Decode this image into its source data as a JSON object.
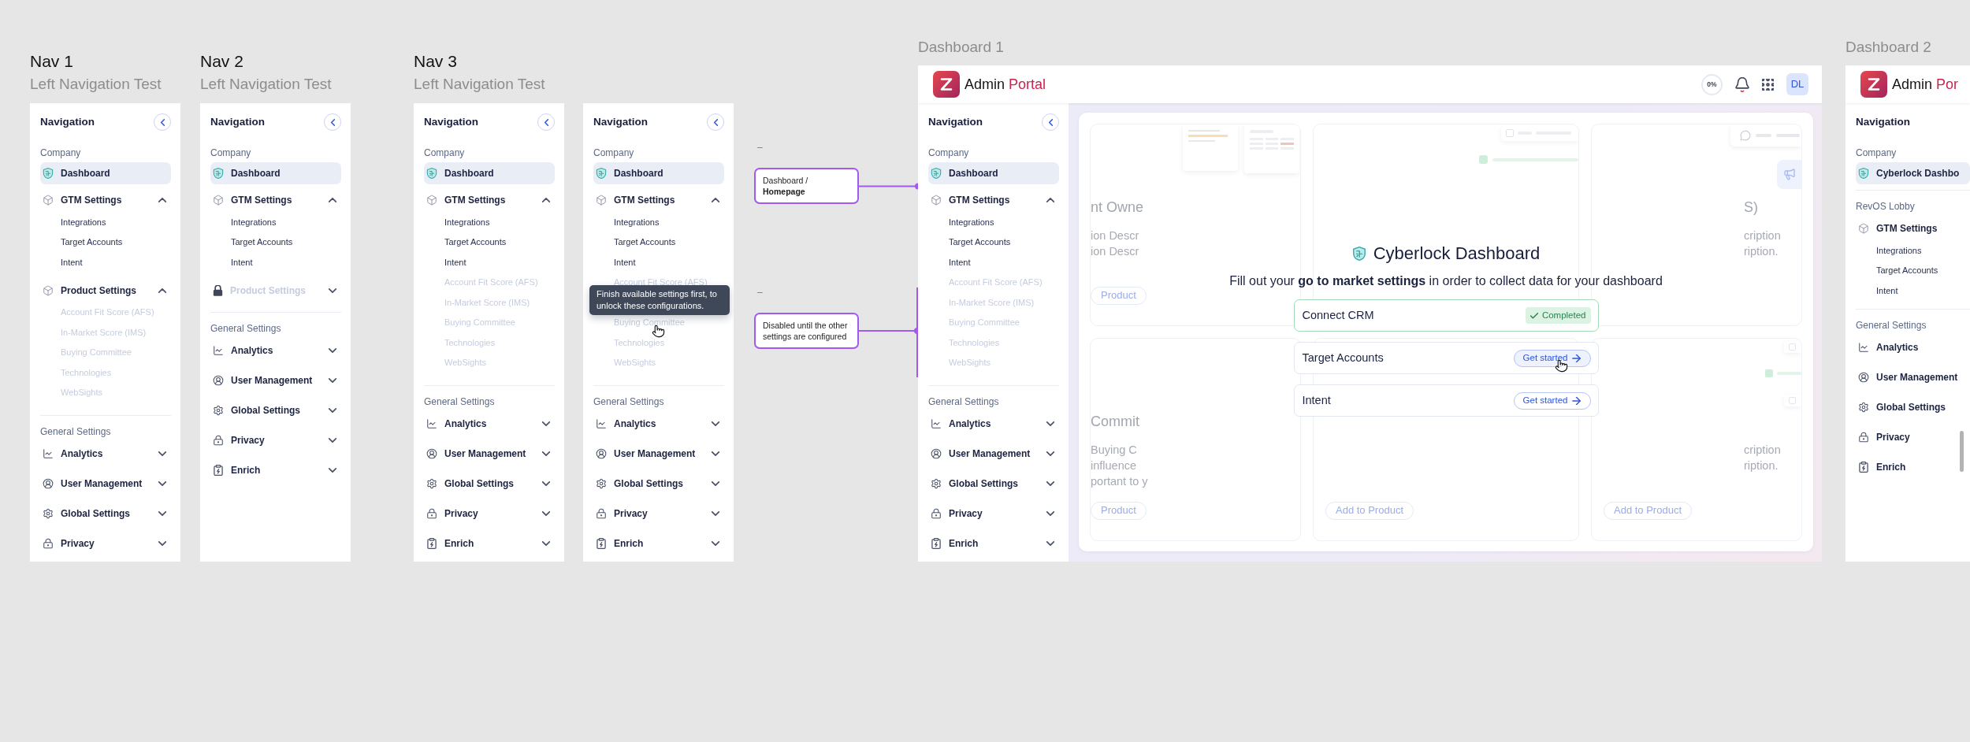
{
  "nav_frames": [
    {
      "title": "Nav 1",
      "subtitle": "Left Navigation Test",
      "panels": [
        {
          "heading": "Navigation",
          "collapsible": true,
          "sections": [
            {
              "label": "Company",
              "items": [
                {
                  "label": "Dashboard",
                  "kind": "shield",
                  "selected": true,
                  "disabled": false
                },
                {
                  "label": "GTM Settings",
                  "kind": "cube",
                  "selected": false,
                  "disabled": false,
                  "expanded": true,
                  "children": [
                    {
                      "label": "Integrations",
                      "selected": false,
                      "disabled": false
                    },
                    {
                      "label": "Target Accounts",
                      "selected": false,
                      "disabled": false
                    },
                    {
                      "label": "Intent",
                      "selected": false,
                      "disabled": false
                    }
                  ]
                },
                {
                  "label": "Product Settings",
                  "kind": "cube",
                  "selected": false,
                  "disabled": false,
                  "expanded": true,
                  "children": [
                    {
                      "label": "Account Fit Score (AFS)",
                      "selected": false,
                      "disabled": true
                    },
                    {
                      "label": "In-Market Score (IMS)",
                      "selected": false,
                      "disabled": true
                    },
                    {
                      "label": "Buying Committee",
                      "selected": false,
                      "disabled": true
                    },
                    {
                      "label": "Technologies",
                      "selected": false,
                      "disabled": true
                    },
                    {
                      "label": "WebSights",
                      "selected": false,
                      "disabled": true
                    }
                  ]
                }
              ]
            },
            {
              "label": "General Settings",
              "items": [
                {
                  "label": "Analytics",
                  "kind": "chart",
                  "selected": false,
                  "disabled": false,
                  "expanded": false
                },
                {
                  "label": "User Management",
                  "kind": "user",
                  "selected": false,
                  "disabled": false,
                  "expanded": false
                },
                {
                  "label": "Global Settings",
                  "kind": "gear",
                  "selected": false,
                  "disabled": false,
                  "expanded": false
                },
                {
                  "label": "Privacy",
                  "kind": "lock",
                  "selected": false,
                  "disabled": false,
                  "expanded": false
                }
              ]
            }
          ]
        }
      ]
    },
    {
      "title": "Nav 2",
      "subtitle": "Left Navigation Test",
      "panels": [
        {
          "heading": "Navigation",
          "collapsible": true,
          "sections": [
            {
              "label": "Company",
              "items": [
                {
                  "label": "Dashboard",
                  "kind": "shield",
                  "selected": true,
                  "disabled": false
                },
                {
                  "label": "GTM Settings",
                  "kind": "cube",
                  "selected": false,
                  "disabled": false,
                  "expanded": true,
                  "children": [
                    {
                      "label": "Integrations",
                      "selected": false,
                      "disabled": false
                    },
                    {
                      "label": "Target Accounts",
                      "selected": false,
                      "disabled": false
                    },
                    {
                      "label": "Intent",
                      "selected": false,
                      "disabled": false
                    }
                  ]
                },
                {
                  "label": "Product Settings",
                  "kind": "cube",
                  "selected": false,
                  "disabled": true,
                  "expanded": false
                }
              ]
            },
            {
              "label": "General Settings",
              "items": [
                {
                  "label": "Analytics",
                  "kind": "chart",
                  "selected": false,
                  "disabled": false,
                  "expanded": false
                },
                {
                  "label": "User Management",
                  "kind": "user",
                  "selected": false,
                  "disabled": false,
                  "expanded": false
                },
                {
                  "label": "Global Settings",
                  "kind": "gear",
                  "selected": false,
                  "disabled": false,
                  "expanded": false
                },
                {
                  "label": "Privacy",
                  "kind": "lock",
                  "selected": false,
                  "disabled": false,
                  "expanded": false
                },
                {
                  "label": "Enrich",
                  "kind": "clipboard",
                  "selected": false,
                  "disabled": false,
                  "expanded": false
                }
              ]
            }
          ]
        }
      ]
    },
    {
      "title": "Nav 3",
      "subtitle": "Left Navigation Test",
      "panels": [
        {
          "heading": "Navigation",
          "collapsible": true,
          "sections": [
            {
              "label": "Company",
              "items": [
                {
                  "label": "Dashboard",
                  "kind": "shield",
                  "selected": true,
                  "disabled": false
                },
                {
                  "label": "GTM Settings",
                  "kind": "cube",
                  "selected": false,
                  "disabled": false,
                  "expanded": true,
                  "children": [
                    {
                      "label": "Integrations",
                      "selected": false,
                      "disabled": false
                    },
                    {
                      "label": "Target Accounts",
                      "selected": false,
                      "disabled": false
                    },
                    {
                      "label": "Intent",
                      "selected": false,
                      "disabled": false
                    },
                    {
                      "label": "Account Fit Score (AFS)",
                      "selected": false,
                      "disabled": true
                    },
                    {
                      "label": "In-Market Score (IMS)",
                      "selected": false,
                      "disabled": true
                    },
                    {
                      "label": "Buying Committee",
                      "selected": false,
                      "disabled": true
                    },
                    {
                      "label": "Technologies",
                      "selected": false,
                      "disabled": true
                    },
                    {
                      "label": "WebSights",
                      "selected": false,
                      "disabled": true
                    }
                  ]
                }
              ]
            },
            {
              "label": "General Settings",
              "items": [
                {
                  "label": "Analytics",
                  "kind": "chart",
                  "selected": false,
                  "disabled": false,
                  "expanded": false
                },
                {
                  "label": "User Management",
                  "kind": "user",
                  "selected": false,
                  "disabled": false,
                  "expanded": false
                },
                {
                  "label": "Global Settings",
                  "kind": "gear",
                  "selected": false,
                  "disabled": false,
                  "expanded": false
                },
                {
                  "label": "Privacy",
                  "kind": "lock",
                  "selected": false,
                  "disabled": false,
                  "expanded": false
                },
                {
                  "label": "Enrich",
                  "kind": "clipboard",
                  "selected": false,
                  "disabled": false,
                  "expanded": false
                }
              ]
            }
          ]
        },
        {
          "heading": "Navigation",
          "collapsible": true,
          "sections": [
            {
              "label": "Company",
              "items": [
                {
                  "label": "Dashboard",
                  "kind": "shield",
                  "selected": true,
                  "disabled": false
                },
                {
                  "label": "GTM Settings",
                  "kind": "cube",
                  "selected": false,
                  "disabled": false,
                  "expanded": true,
                  "children": [
                    {
                      "label": "Integrations",
                      "selected": false,
                      "disabled": false
                    },
                    {
                      "label": "Target Accounts",
                      "selected": false,
                      "disabled": false
                    },
                    {
                      "label": "Intent",
                      "selected": false,
                      "disabled": false
                    },
                    {
                      "label": "Account Fit Score (AFS)",
                      "selected": false,
                      "disabled": true
                    },
                    {
                      "label": "Buying Committee",
                      "selected": false,
                      "disabled": true,
                      "tooltip": "Finish available settings first, to unlock these configurations."
                    },
                    {
                      "label": "Technologies",
                      "selected": false,
                      "disabled": true
                    },
                    {
                      "label": "WebSights",
                      "selected": false,
                      "disabled": true
                    }
                  ]
                }
              ]
            },
            {
              "label": "General Settings",
              "items": [
                {
                  "label": "Analytics",
                  "kind": "chart",
                  "selected": false,
                  "disabled": false,
                  "expanded": false
                },
                {
                  "label": "User Management",
                  "kind": "user",
                  "selected": false,
                  "disabled": false,
                  "expanded": false
                },
                {
                  "label": "Global Settings",
                  "kind": "gear",
                  "selected": false,
                  "disabled": false,
                  "expanded": false
                },
                {
                  "label": "Privacy",
                  "kind": "lock",
                  "selected": false,
                  "disabled": false,
                  "expanded": false
                },
                {
                  "label": "Enrich",
                  "kind": "clipboard",
                  "selected": false,
                  "disabled": false,
                  "expanded": false
                }
              ]
            }
          ]
        }
      ]
    }
  ],
  "annotations": [
    {
      "label": "–",
      "text": "Dashboard / **Homepage**",
      "kind": "point"
    },
    {
      "label": "–",
      "text": "Disabled until the other settings are configured",
      "kind": "range"
    }
  ],
  "dashboards": [
    {
      "title": "Dashboard 1",
      "header": {
        "logo": {
          "first": "Admin",
          "second": "Portal"
        },
        "progress": "0%",
        "avatar": "DL"
      },
      "sidebar": {
        "heading": "Navigation",
        "collapsible": true,
        "sections": [
          {
            "label": "Company",
            "items": [
              {
                "label": "Dashboard",
                "kind": "shield",
                "selected": true,
                "disabled": false
              },
              {
                "label": "GTM Settings",
                "kind": "cube",
                "selected": false,
                "disabled": false,
                "expanded": true,
                "children": [
                  {
                    "label": "Integrations",
                    "selected": false,
                    "disabled": false
                  },
                  {
                    "label": "Target Accounts",
                    "selected": false,
                    "disabled": false
                  },
                  {
                    "label": "Intent",
                    "selected": false,
                    "disabled": false
                  },
                  {
                    "label": "Account Fit Score (AFS)",
                    "selected": false,
                    "disabled": true
                  },
                  {
                    "label": "In-Market Score (IMS)",
                    "selected": false,
                    "disabled": true
                  },
                  {
                    "label": "Buying Committee",
                    "selected": false,
                    "disabled": true
                  },
                  {
                    "label": "Technologies",
                    "selected": false,
                    "disabled": true
                  },
                  {
                    "label": "WebSights",
                    "selected": false,
                    "disabled": true
                  }
                ]
              }
            ]
          },
          {
            "label": "General Settings",
            "items": [
              {
                "label": "Analytics",
                "kind": "chart",
                "selected": false,
                "disabled": false,
                "expanded": false
              },
              {
                "label": "User Management",
                "kind": "user",
                "selected": false,
                "disabled": false,
                "expanded": false
              },
              {
                "label": "Global Settings",
                "kind": "gear",
                "selected": false,
                "disabled": false,
                "expanded": false
              },
              {
                "label": "Privacy",
                "kind": "lock",
                "selected": false,
                "disabled": false,
                "expanded": false
              },
              {
                "label": "Enrich",
                "kind": "clipboard",
                "selected": false,
                "disabled": false,
                "expanded": false
              }
            ]
          }
        ]
      },
      "main": {
        "background_cards": [
          {
            "kind": "documents",
            "title": "nt Owne",
            "lines": [
              "ion Descr",
              "ion Descr"
            ],
            "button": "Product"
          },
          {
            "kind": "checklist"
          },
          {
            "kind": "chat",
            "title": "S)",
            "lines": [
              "cription",
              "ription."
            ]
          },
          {
            "kind": "plain",
            "title": "Commit",
            "lines": [
              "Buying C",
              "influence",
              "portant to y"
            ],
            "button": "Product"
          },
          {
            "kind": "plain",
            "button": "Add to Product"
          },
          {
            "kind": "side-checklist",
            "lines": [
              "cription",
              "ription."
            ],
            "button": "Add to Product"
          }
        ],
        "heading": "Cyberlock Dashboard",
        "subtitle": "Fill out your **go to market settings** in order to collect data for your dashboard",
        "steps": [
          {
            "label": "Connect CRM",
            "kind": "done",
            "status": "Completed"
          },
          {
            "label": "Target Accounts",
            "kind": "todo",
            "action": "Get started",
            "hovered": true
          },
          {
            "label": "Intent",
            "kind": "todo",
            "action": "Get started",
            "hovered": false
          }
        ]
      }
    },
    {
      "title": "Dashboard 2",
      "header": {
        "logo": {
          "first": "Admin",
          "second": "Por"
        }
      },
      "sidebar": {
        "heading": "Navigation",
        "sections": [
          {
            "label": "Company",
            "items": [
              {
                "label": "Cyberlock Dashbo",
                "kind": "shield",
                "selected": true,
                "disabled": false
              }
            ]
          },
          {
            "label": "RevOS Lobby",
            "items": [
              {
                "label": "GTM Settings",
                "kind": "cube",
                "selected": false,
                "disabled": false,
                "children": [
                  {
                    "label": "Integrations",
                    "selected": false,
                    "disabled": false
                  },
                  {
                    "label": "Target Accounts",
                    "selected": false,
                    "disabled": false
                  },
                  {
                    "label": "Intent",
                    "selected": false,
                    "disabled": false
                  }
                ]
              }
            ]
          },
          {
            "label": "General Settings",
            "items": [
              {
                "label": "Analytics",
                "kind": "chart",
                "selected": false,
                "disabled": false
              },
              {
                "label": "User Management",
                "kind": "user",
                "selected": false,
                "disabled": false
              },
              {
                "label": "Global Settings",
                "kind": "gear",
                "selected": false,
                "disabled": false
              },
              {
                "label": "Privacy",
                "kind": "lock",
                "selected": false,
                "disabled": false
              },
              {
                "label": "Enrich",
                "kind": "clipboard",
                "selected": false,
                "disabled": false
              }
            ]
          }
        ]
      }
    }
  ]
}
